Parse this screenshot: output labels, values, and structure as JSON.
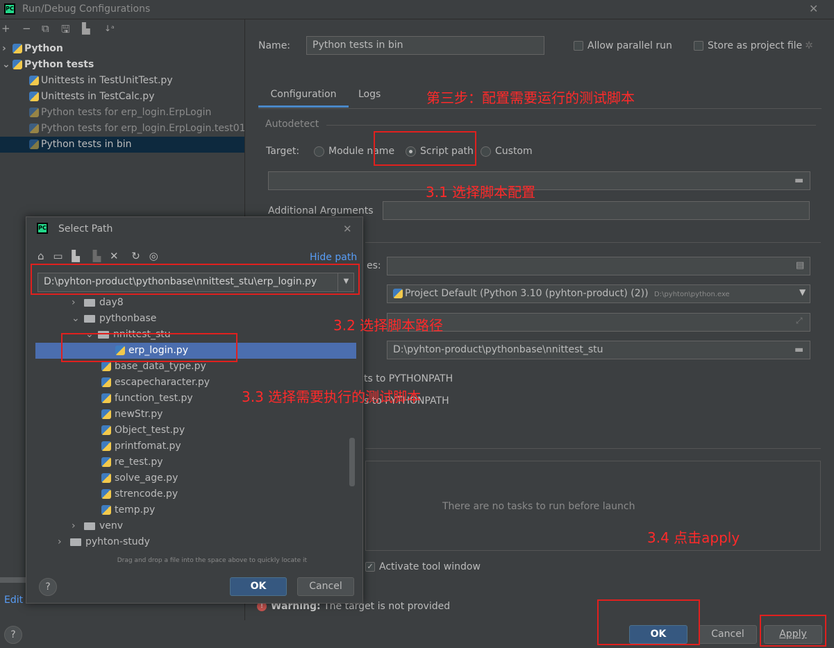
{
  "window": {
    "title": "Run/Debug Configurations",
    "close": "✕"
  },
  "toolbar": {
    "add": "+",
    "remove": "−",
    "copy": "⧉",
    "save": "🖫",
    "folder": "▙",
    "sort": "↓ᵃ"
  },
  "tree": {
    "groups": [
      {
        "arrow": "›",
        "label": "Python"
      },
      {
        "arrow": "⌄",
        "label": "Python tests"
      }
    ],
    "items": [
      {
        "label": "Unittests in TestUnitTest.py"
      },
      {
        "label": "Unittests in TestCalc.py"
      },
      {
        "label": "Python tests for erp_login.ErpLogin"
      },
      {
        "label": "Python tests for erp_login.ErpLogin.test01"
      },
      {
        "label": "Python tests in bin"
      }
    ]
  },
  "left_bottom": {
    "edit_label": "Edit",
    "help": "?"
  },
  "form": {
    "name_label": "Name:",
    "name_value": "Python tests in bin",
    "allow_parallel": "Allow parallel run",
    "store_as_project": "Store as project file",
    "tabs": [
      {
        "label": "Configuration"
      },
      {
        "label": "Logs"
      }
    ],
    "autodetect": "Autodetect",
    "target_label": "Target:",
    "target_options": [
      {
        "label": "Module name"
      },
      {
        "label": "Script path"
      },
      {
        "label": "Custom"
      }
    ],
    "additional_args": "Additional Arguments",
    "env_vars_tail": "es:",
    "interpreter": "Project Default (Python 3.10 (pyhton-product) (2))",
    "interpreter_path": "D:\\pyhton\\python.exe",
    "working_dir": "D:\\pyhton-product\\pythonbase\\nnittest_stu",
    "add_content_roots": "ts to PYTHONPATH",
    "add_source_roots": "s to PYTHONPATH",
    "no_tasks": "There are no tasks to run before launch",
    "activate_tool": "Activate tool window",
    "warning_bold": "Warning:",
    "warning_text": "The target is not provided"
  },
  "buttons": {
    "ok": "OK",
    "cancel": "Cancel",
    "apply": "Apply"
  },
  "annotations": {
    "step3": "第三步：配置需要运行的测试脚本",
    "step3_1": "3.1 选择脚本配置",
    "step3_2": "3.2 选择脚本路径",
    "step3_3": "3.3 选择需要执行的测试脚本",
    "step3_4": "3.4 点击apply"
  },
  "select_path": {
    "title": "Select Path",
    "close": "✕",
    "hide_path": "Hide path",
    "path_value": "D:\\pyhton-product\\pythonbase\\nnittest_stu\\erp_login.py",
    "tree": [
      {
        "label": "day8",
        "arrow": "›"
      },
      {
        "label": "pythonbase",
        "arrow": "⌄"
      },
      {
        "label": "nnittest_stu",
        "arrow": "⌄"
      },
      {
        "label": "erp_login.py"
      },
      {
        "label": "base_data_type.py"
      },
      {
        "label": "escapecharacter.py"
      },
      {
        "label": "function_test.py"
      },
      {
        "label": "newStr.py"
      },
      {
        "label": "Object_test.py"
      },
      {
        "label": "printfomat.py"
      },
      {
        "label": "re_test.py"
      },
      {
        "label": "solve_age.py"
      },
      {
        "label": "strencode.py"
      },
      {
        "label": "temp.py"
      },
      {
        "label": "venv",
        "arrow": "›"
      },
      {
        "label": "pyhton-study",
        "arrow": "›"
      }
    ],
    "hint": "Drag and drop a file into the space above to quickly locate it",
    "help": "?",
    "ok": "OK",
    "cancel": "Cancel"
  },
  "colors": {
    "accent": "#4a88c7",
    "annotation": "#ff2a2a",
    "selection": "#0d293e",
    "primary_button": "#365880"
  }
}
